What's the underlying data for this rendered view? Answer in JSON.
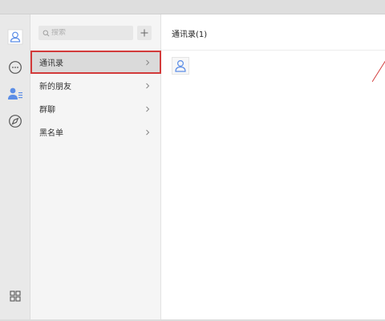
{
  "search": {
    "placeholder": "搜索"
  },
  "menu": {
    "items": [
      {
        "label": "通讯录"
      },
      {
        "label": "新的朋友"
      },
      {
        "label": "群聊"
      },
      {
        "label": "黑名单"
      }
    ]
  },
  "content": {
    "title": "通讯录(1)"
  },
  "colors": {
    "accent": "#5b8de6",
    "highlight_border": "#d23a3a"
  },
  "icons": [
    "user-icon",
    "chat-icon",
    "contacts-icon",
    "compass-icon",
    "apps-icon",
    "search-icon",
    "plus-icon",
    "chevron-right-icon",
    "contact-avatar-icon"
  ]
}
